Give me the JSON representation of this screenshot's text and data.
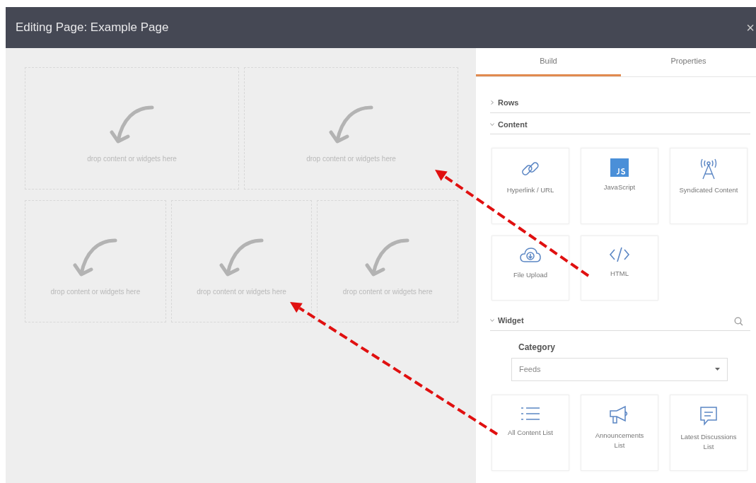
{
  "window": {
    "title": "Editing Page: Example Page",
    "close": "×"
  },
  "canvas": {
    "rows": [
      {
        "zones": [
          {
            "text": "drop content or widgets here"
          },
          {
            "text": "drop content or widgets here"
          }
        ]
      },
      {
        "zones": [
          {
            "text": "drop content or widgets here"
          },
          {
            "text": "drop content or widgets here"
          },
          {
            "text": "drop content or widgets here"
          }
        ]
      }
    ]
  },
  "tabs": [
    {
      "label": "Build",
      "selected": true
    },
    {
      "label": "Properties",
      "selected": false
    }
  ],
  "sections": [
    {
      "title": "Rows",
      "expanded": false
    },
    {
      "title": "Content",
      "expanded": true,
      "items": [
        {
          "label": "Hyperlink / URL"
        },
        {
          "label": "JavaScript"
        },
        {
          "label": "Syndicated Content"
        },
        {
          "label": "File Upload"
        },
        {
          "label": "HTML"
        }
      ]
    },
    {
      "title": "Widget",
      "expanded": true,
      "search": true,
      "category": {
        "label": "Category",
        "value": "Feeds"
      },
      "items": [
        {
          "label": "All Content List"
        },
        {
          "label": "Announcements List"
        },
        {
          "label": "Latest Discussions List"
        }
      ]
    }
  ]
}
